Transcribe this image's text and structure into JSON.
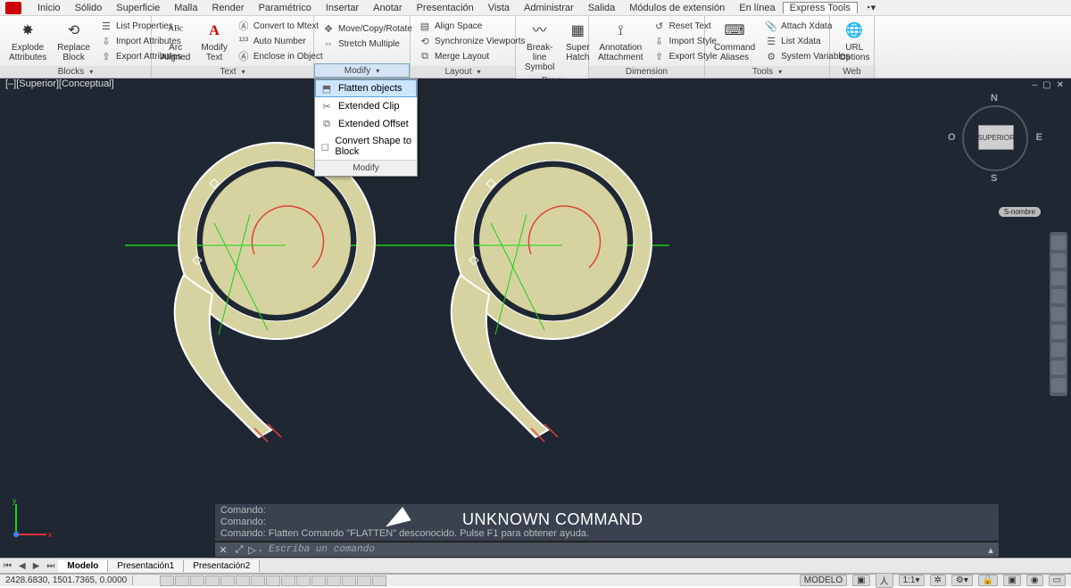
{
  "menus": [
    "Inicio",
    "Sólido",
    "Superficie",
    "Malla",
    "Render",
    "Paramétrico",
    "Insertar",
    "Anotar",
    "Presentación",
    "Vista",
    "Administrar",
    "Salida",
    "Módulos de extensión",
    "En línea",
    "Express Tools"
  ],
  "active_menu": 14,
  "ribbon": {
    "blocks": {
      "title": "Blocks",
      "explode": "Explode\nAttributes",
      "replace": "Replace\nBlock",
      "list_props": "List Properties",
      "import_attr": "Import Attributes",
      "export_attr": "Export Attributes"
    },
    "text": {
      "title": "Text",
      "arc_aligned": "Arc\nAligned",
      "modify_text": "Modify\nText",
      "convert_mtext": "Convert to Mtext",
      "auto_number": "Auto Number",
      "enclose": "Enclose in Object"
    },
    "modify": {
      "title": "Modify",
      "move_copy": "Move/Copy/Rotate",
      "stretch": "Stretch Multiple"
    },
    "layout": {
      "title": "Layout",
      "align_space": "Align Space",
      "sync_vp": "Synchronize Viewports",
      "merge_layout": "Merge Layout"
    },
    "draw": {
      "title": "Draw",
      "breakline": "Break-line\nSymbol",
      "super_hatch": "Super\nHatch"
    },
    "dimension": {
      "title": "Dimension",
      "anno_attach": "Annotation\nAttachment",
      "reset_text": "Reset Text",
      "import_style": "Import Style",
      "export_style": "Export Style"
    },
    "tools": {
      "title": "Tools",
      "cmd_alias": "Command\nAliases",
      "attach_xdata": "Attach Xdata",
      "list_xdata": "List Xdata",
      "sys_vars": "System Variables"
    },
    "web": {
      "title": "Web",
      "url_options": "URL\nOptions"
    }
  },
  "dropdown": {
    "items": [
      "Flatten objects",
      "Extended Clip",
      "Extended Offset",
      "Convert Shape to Block"
    ],
    "foot": "Modify"
  },
  "viewport_label": "[–][Superior][Conceptual]",
  "viewcube": {
    "face": "SUPERIOR",
    "n": "N",
    "s": "S",
    "e": "E",
    "w": "O"
  },
  "snombre": "S-nombre",
  "command": {
    "hist1": "Comando:",
    "hist2": "Comando:",
    "hist3": "Comando: Flatten Comando \"FLATTEN\" desconocido. Pulse F1 para obtener ayuda.",
    "placeholder": "Escriba un comando",
    "prompt": "▷ -"
  },
  "annotation": "UNKNOWN COMMAND",
  "canvas_tabs": {
    "model": "Modelo",
    "p1": "Presentación1",
    "p2": "Presentación2"
  },
  "status": {
    "coords": "2428.6830, 1501.7365, 0.0000",
    "modelo": "MODELO",
    "scale": "1:1"
  }
}
